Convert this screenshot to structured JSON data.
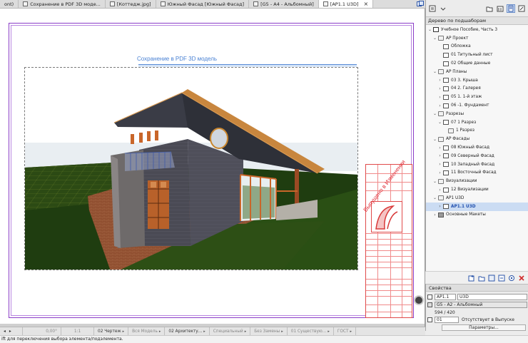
{
  "tabs": [
    {
      "label": "ont)",
      "icon": "none",
      "active": false,
      "closable": false
    },
    {
      "label": "Сохранение в PDF 3D моде...",
      "icon": "layout-icon",
      "active": false,
      "closable": false
    },
    {
      "label": "[Коттедж.jpg]",
      "icon": "image-icon",
      "active": false,
      "closable": false
    },
    {
      "label": "Южный Фасад [Южный Фасад]",
      "icon": "elevation-icon",
      "active": false,
      "closable": false
    },
    {
      "label": "[G5 - A4 - Альбомный]",
      "icon": "layout-icon",
      "active": false,
      "closable": false
    },
    {
      "label": "[АР1.1 U3D]",
      "icon": "layout-icon",
      "active": true,
      "closable": true,
      "close_glyph": "×"
    }
  ],
  "canvas": {
    "view_title": "Сохранение в PDF 3D модель",
    "watermark": "Выпущено в Изменении",
    "frame_color": "#8a3cc7",
    "title_color": "#4a82d4",
    "titleblock_color": "#e04a4a"
  },
  "navigator": {
    "header": "Дерево по подшаборам",
    "tree": [
      {
        "label": "Учебное Пособие, Часть 3",
        "depth": 0,
        "icon": "book-icon",
        "expanded": true
      },
      {
        "label": "АР Проект",
        "depth": 1,
        "icon": "folder-icon",
        "expanded": true
      },
      {
        "label": "Обложка",
        "depth": 2,
        "icon": "layout-icon"
      },
      {
        "label": "01 Титульный лист",
        "depth": 2,
        "icon": "layout-icon"
      },
      {
        "label": "02 Общие данные",
        "depth": 2,
        "icon": "layout-icon"
      },
      {
        "label": "АР Планы",
        "depth": 1,
        "icon": "folder-icon",
        "expanded": true
      },
      {
        "label": "03 3. Крыша",
        "depth": 2,
        "icon": "layout-icon",
        "collapsed": true
      },
      {
        "label": "04 2. Галерея",
        "depth": 2,
        "icon": "layout-icon",
        "collapsed": true
      },
      {
        "label": "05 1. 1-й этаж",
        "depth": 2,
        "icon": "layout-icon",
        "collapsed": true
      },
      {
        "label": "06 -1. Фундамент",
        "depth": 2,
        "icon": "layout-icon",
        "collapsed": true
      },
      {
        "label": "Разрезы",
        "depth": 1,
        "icon": "folder-icon",
        "expanded": true
      },
      {
        "label": "07 1 Разрез",
        "depth": 2,
        "icon": "layout-icon",
        "expanded": true
      },
      {
        "label": "1 Разрез",
        "depth": 3,
        "icon": "folder-icon"
      },
      {
        "label": "АР Фасады",
        "depth": 1,
        "icon": "folder-icon",
        "expanded": true
      },
      {
        "label": "08 Южный Фасад",
        "depth": 2,
        "icon": "layout-icon",
        "collapsed": true
      },
      {
        "label": "09 Северный Фасад",
        "depth": 2,
        "icon": "layout-icon",
        "collapsed": true
      },
      {
        "label": "10 Западный Фасад",
        "depth": 2,
        "icon": "layout-icon",
        "collapsed": true
      },
      {
        "label": "11 Восточный Фасад",
        "depth": 2,
        "icon": "layout-icon",
        "collapsed": true
      },
      {
        "label": "Визуализации",
        "depth": 1,
        "icon": "folder-icon",
        "expanded": true
      },
      {
        "label": "12 Визуализации",
        "depth": 2,
        "icon": "layout-icon",
        "collapsed": true
      },
      {
        "label": "АР1 U3D",
        "depth": 1,
        "icon": "folder-icon",
        "expanded": true
      },
      {
        "label": "АР1.1 U3D",
        "depth": 2,
        "icon": "layout-icon",
        "collapsed": true,
        "selected": true
      },
      {
        "label": "Основные Макеты",
        "depth": 1,
        "icon": "master-icon",
        "collapsed": true
      }
    ]
  },
  "properties": {
    "title": "Свойства",
    "id_value": "АР1.1",
    "name_value": "U3D",
    "master_value": "G5 - A2 - Альбомный",
    "size_value": "594 / 420",
    "revision_value": "01",
    "revision_text": "Отсутствует в Выпуске",
    "params_button": "Параметры..."
  },
  "statusbar": {
    "items": [
      {
        "label": "",
        "kind": "undo"
      },
      {
        "label": "0,00°",
        "kind": "angle",
        "dim": true
      },
      {
        "label": "1:1",
        "kind": "scale",
        "dim": true
      },
      {
        "label": "02 Чертеж",
        "kind": "dropdown"
      },
      {
        "label": "Вся Модель",
        "kind": "dropdown",
        "dim": true
      },
      {
        "label": "02 Архитекту...",
        "kind": "dropdown"
      },
      {
        "label": "Специальный",
        "kind": "dropdown",
        "dim": true
      },
      {
        "label": "Без Замены",
        "kind": "dropdown",
        "dim": true
      },
      {
        "label": "01 Существую...",
        "kind": "dropdown",
        "dim": true
      },
      {
        "label": "ГОСТ",
        "kind": "dropdown",
        "dim": true
      }
    ]
  },
  "hint": "ift для переключения выбора элемента/подэлемента."
}
